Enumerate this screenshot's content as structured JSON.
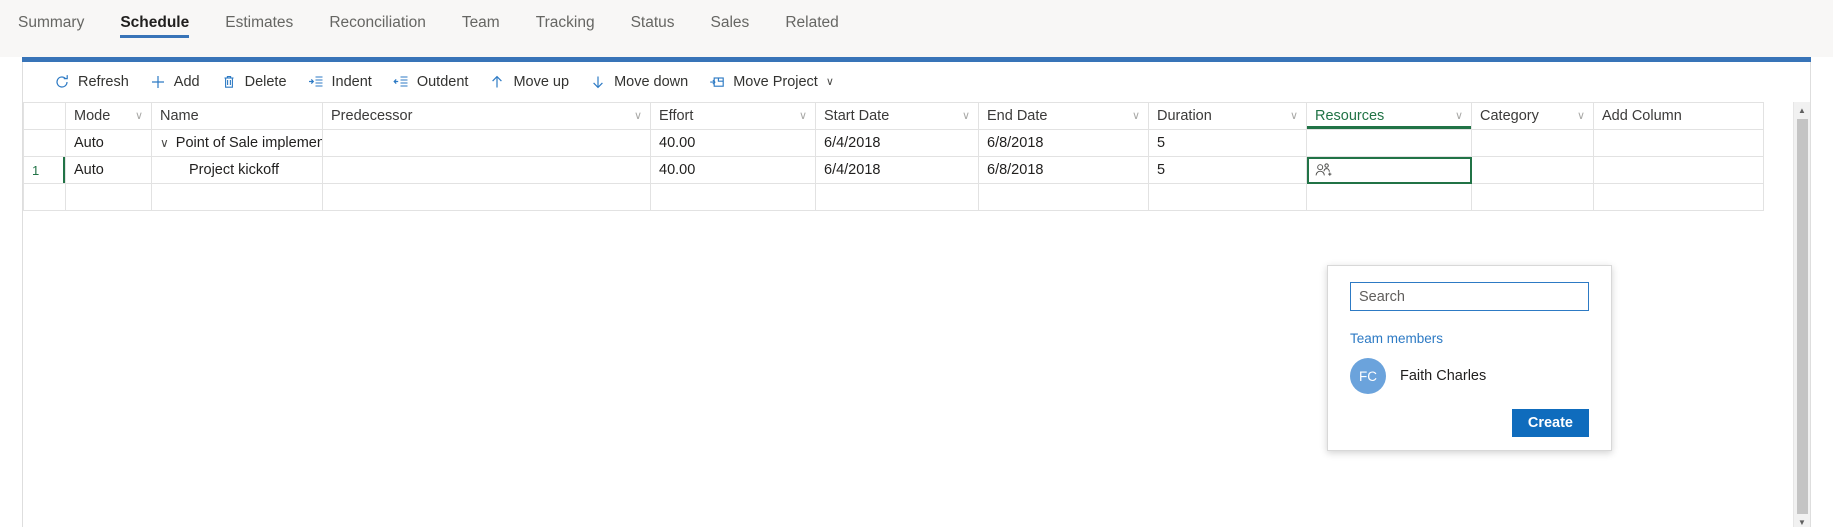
{
  "nav": {
    "tabs": [
      {
        "label": "Summary",
        "active": false
      },
      {
        "label": "Schedule",
        "active": true
      },
      {
        "label": "Estimates",
        "active": false
      },
      {
        "label": "Reconciliation",
        "active": false
      },
      {
        "label": "Team",
        "active": false
      },
      {
        "label": "Tracking",
        "active": false
      },
      {
        "label": "Status",
        "active": false
      },
      {
        "label": "Sales",
        "active": false
      },
      {
        "label": "Related",
        "active": false
      }
    ]
  },
  "toolbar": {
    "refresh_label": "Refresh",
    "add_label": "Add",
    "delete_label": "Delete",
    "indent_label": "Indent",
    "outdent_label": "Outdent",
    "move_up_label": "Move up",
    "move_down_label": "Move down",
    "move_project_label": "Move Project"
  },
  "grid": {
    "headers": {
      "rownum": "",
      "mode": "Mode",
      "name": "Name",
      "predecessor": "Predecessor",
      "effort": "Effort",
      "start_date": "Start Date",
      "end_date": "End Date",
      "duration": "Duration",
      "resources": "Resources",
      "category": "Category",
      "add_column": "Add Column"
    },
    "rows": [
      {
        "rownum": "",
        "mode": "Auto",
        "name": "Point of Sale implementation",
        "predecessor": "",
        "effort": "40.00",
        "start_date": "6/4/2018",
        "end_date": "6/8/2018",
        "duration": "5",
        "resources": "",
        "category": "",
        "add_column": ""
      },
      {
        "rownum": "1",
        "mode": "Auto",
        "name": "Project kickoff",
        "predecessor": "",
        "effort": "40.00",
        "start_date": "6/4/2018",
        "end_date": "6/8/2018",
        "duration": "5",
        "resources": "",
        "category": "",
        "add_column": ""
      },
      {
        "rownum": "",
        "mode": "",
        "name": "",
        "predecessor": "",
        "effort": "",
        "start_date": "",
        "end_date": "",
        "duration": "",
        "resources": "",
        "category": "",
        "add_column": ""
      }
    ]
  },
  "resource_popup": {
    "search_value": "",
    "search_placeholder": "Search",
    "team_members_label": "Team members",
    "member_initials": "FC",
    "member_name": "Faith Charles",
    "create_label": "Create"
  },
  "colors": {
    "accent_blue": "#3874b8",
    "icon_blue": "#2d7ac4",
    "active_green": "#217346",
    "button_blue": "#0f6cbd",
    "avatar_blue": "#6ba3dc"
  }
}
